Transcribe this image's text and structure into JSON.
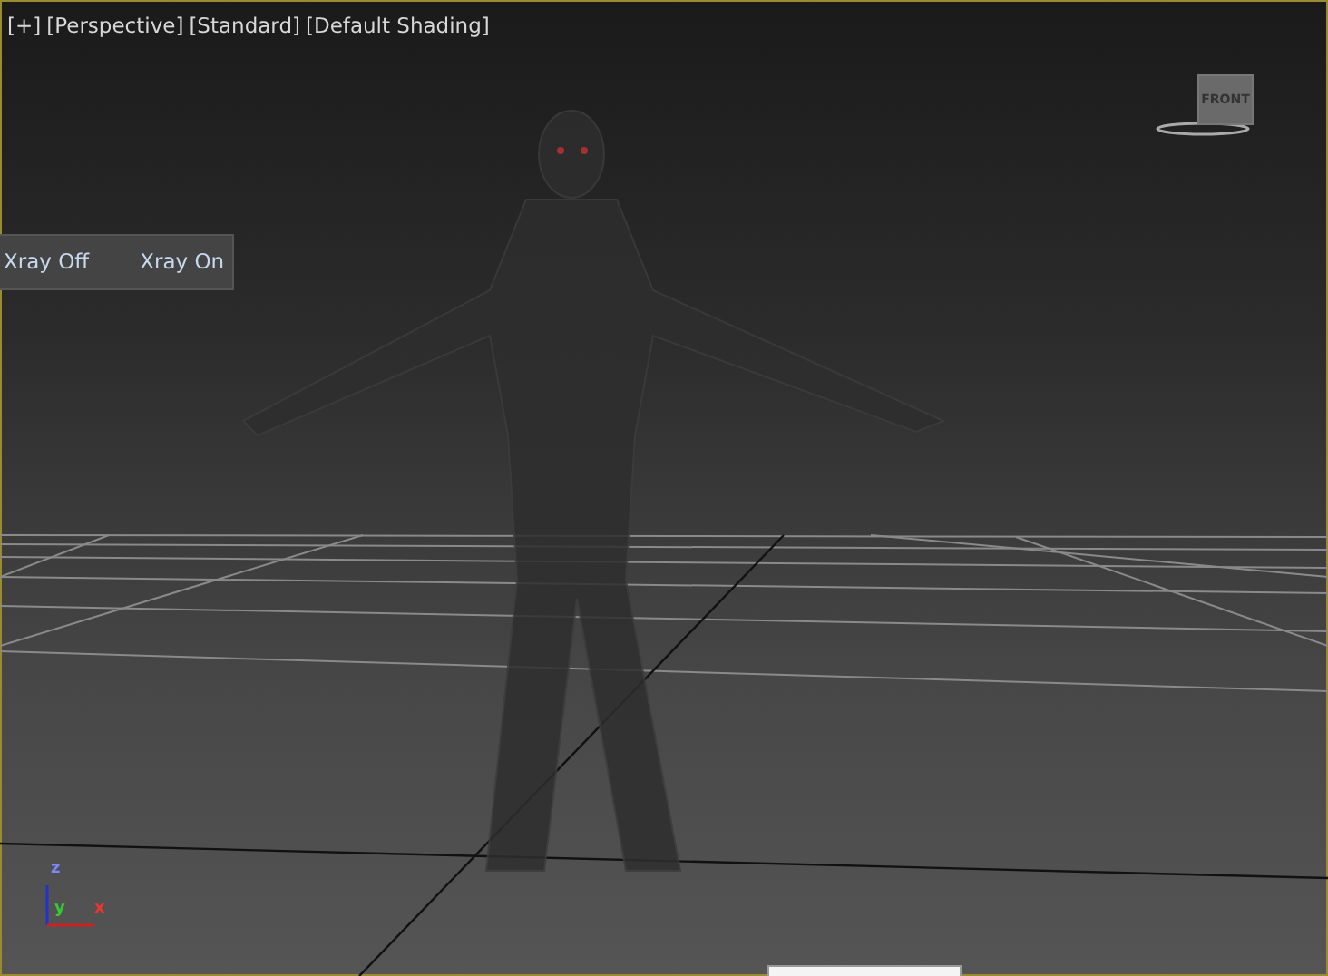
{
  "viewport": {
    "labels": [
      "[+]",
      "[Perspective]",
      "[Standard]",
      "[Default Shading]"
    ],
    "active": true,
    "viewcube": {
      "face": "FRONT"
    },
    "xray_toolbar": [
      {
        "label": "Xray Off"
      },
      {
        "label": "Xray On"
      }
    ],
    "axis_tripod": {
      "z": "z",
      "y": "y",
      "x": "x"
    }
  }
}
